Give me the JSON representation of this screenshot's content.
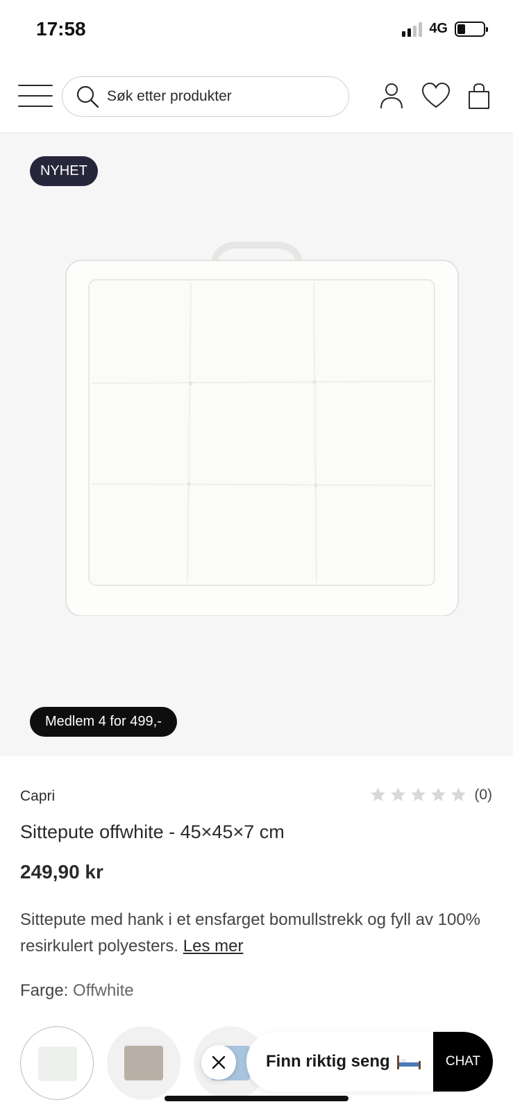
{
  "status_bar": {
    "time": "17:58",
    "network": "4G"
  },
  "header": {
    "search_placeholder": "Søk etter produkter",
    "icons": [
      "menu-icon",
      "search-icon",
      "user-icon",
      "heart-icon",
      "bag-icon"
    ]
  },
  "image_area": {
    "badge_new": "NYHET",
    "badge_member": "Medlem 4 for 499,-"
  },
  "product": {
    "brand": "Capri",
    "rating_count": "(0)",
    "rating_stars": 0,
    "title": "Sittepute offwhite - 45×45×7 cm",
    "price": "249,90 kr",
    "description": "Sittepute med hank i et ensfarget bomullstrekk og fyll av 100% resirkulert polyesters. ",
    "read_more": "Les mer",
    "color_label": "Farge:",
    "color_value": "Offwhite"
  },
  "swatches": [
    {
      "name": "offwhite",
      "color": "#eef0ee",
      "selected": true
    },
    {
      "name": "grey",
      "color": "#b8b0a6",
      "selected": false
    },
    {
      "name": "light-blue",
      "color": "#a9c4de",
      "selected": false
    }
  ],
  "chat": {
    "find_bed_label": "Finn riktig seng",
    "chat_label": "CHAT"
  },
  "colors": {
    "badge_new_bg": "#27263b",
    "badge_member_bg": "#0e0e0e",
    "image_bg": "#f6f6f6"
  }
}
